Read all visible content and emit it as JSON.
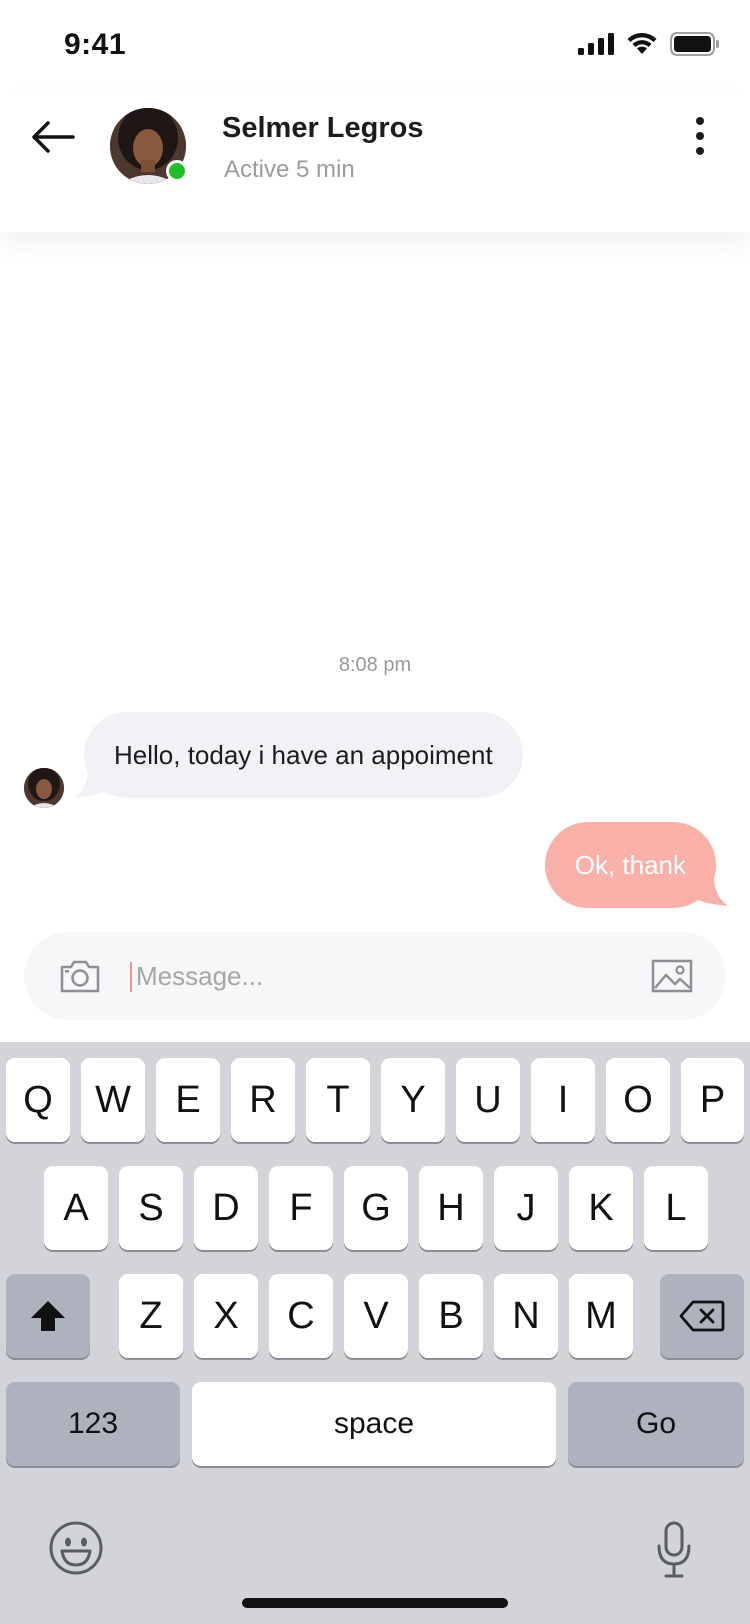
{
  "status_bar": {
    "time": "9:41"
  },
  "header": {
    "contact_name": "Selmer Legros",
    "contact_status": "Active 5 min"
  },
  "chat": {
    "timestamp": "8:08 pm",
    "messages": [
      {
        "direction": "incoming",
        "text": "Hello, today i have an appoiment"
      },
      {
        "direction": "outgoing",
        "text": "Ok, thank"
      }
    ]
  },
  "composer": {
    "placeholder": "Message..."
  },
  "keyboard": {
    "row1": [
      "Q",
      "W",
      "E",
      "R",
      "T",
      "Y",
      "U",
      "I",
      "O",
      "P"
    ],
    "row2": [
      "A",
      "S",
      "D",
      "F",
      "G",
      "H",
      "J",
      "K",
      "L"
    ],
    "row3": [
      "Z",
      "X",
      "C",
      "V",
      "B",
      "N",
      "M"
    ],
    "numbers_key": "123",
    "space_key": "space",
    "go_key": "Go"
  },
  "colors": {
    "outgoing_bubble": "#f9b0a8",
    "incoming_bubble": "#f0f2f6",
    "online_dot": "#1fbf2a",
    "keyboard_bg": "#d2d4da"
  },
  "icons": [
    "back-arrow-icon",
    "more-vertical-icon",
    "camera-icon",
    "image-icon",
    "shift-icon",
    "delete-icon",
    "emoji-icon",
    "microphone-icon",
    "signal-icon",
    "wifi-icon",
    "battery-icon"
  ]
}
